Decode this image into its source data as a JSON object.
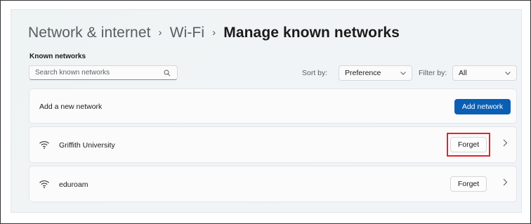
{
  "breadcrumb": {
    "items": [
      "Network & internet",
      "Wi-Fi"
    ],
    "separator": "›",
    "current": "Manage known networks"
  },
  "known_networks": {
    "section_title": "Known networks",
    "search_placeholder": "Search known networks",
    "sort_label": "Sort by:",
    "sort_value": "Preference",
    "filter_label": "Filter by:",
    "filter_value": "All"
  },
  "add_network": {
    "label": "Add a new network",
    "button_label": "Add network",
    "button_color": "#0a5fb4"
  },
  "networks": [
    {
      "name": "Griffith University",
      "forget_label": "Forget",
      "icon": "wifi-icon",
      "highlighted": true
    },
    {
      "name": "eduroam",
      "forget_label": "Forget",
      "icon": "wifi-icon",
      "highlighted": false
    }
  ],
  "colors": {
    "highlight_border": "#e3242b",
    "accent": "#0a5fb4"
  }
}
